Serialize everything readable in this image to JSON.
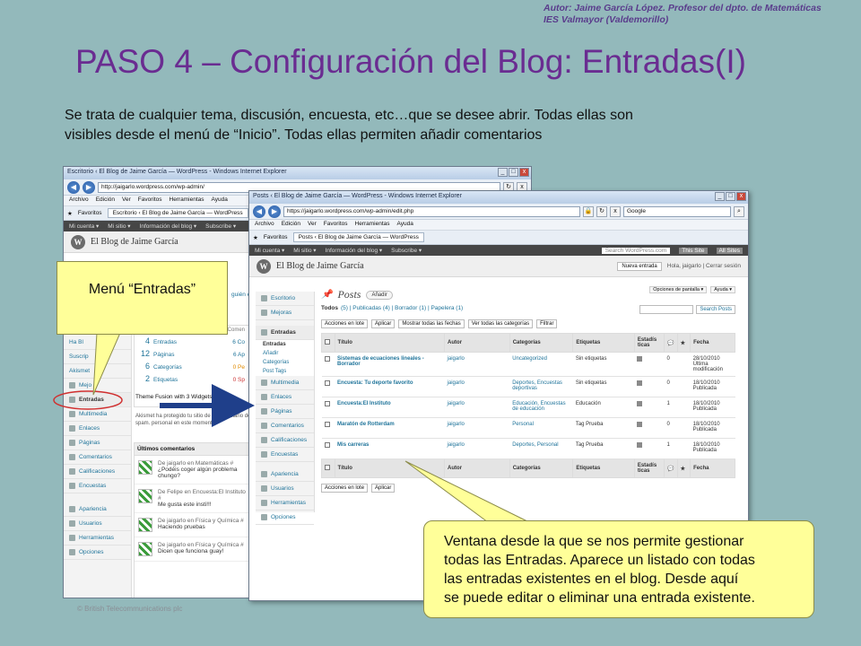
{
  "slide": {
    "author_line1": "Autor: Jaime García López. Profesor del dpto. de Matemáticas",
    "author_line2": "IES Valmayor (Valdemorillo)",
    "title": "PASO 4 – Configuración del Blog: Entradas(I)",
    "intro_line1": "Se trata de cualquier tema, discusión, encuesta, etc…que se desee abrir. Todas ellas son",
    "intro_line2": "visibles desde el menú de “Inicio”. Todas ellas permiten añadir comentarios",
    "copyright": "© British Telecommunications plc"
  },
  "callouts": {
    "menu": "Menú “Entradas”",
    "posts_line1": "Ventana desde la que se nos permite gestionar",
    "posts_line2": "todas las Entradas. Aparece un listado con todas",
    "posts_line3": "las entradas existentes en el blog. Desde aquí",
    "posts_line4": "se puede editar o eliminar una entrada existente."
  },
  "back_window": {
    "title": "Escritorio ‹ El Blog de Jaime García — WordPress - Windows Internet Explorer",
    "url": "http://jaigarlo.wordpress.com/wp-admin/",
    "menu": [
      "Archivo",
      "Edición",
      "Ver",
      "Favoritos",
      "Herramientas",
      "Ayuda"
    ],
    "fav_label": "Favoritos",
    "tab": "Escritorio ‹ El Blog de Jaime García — WordPress",
    "wpbar": [
      "Mi cuenta ▾",
      "Mi sitio ▾",
      "Información del blog ▾",
      "Subscribe ▾"
    ],
    "blog_name": "El Blog de Jaime García",
    "side_items": [
      "Escritorio",
      "Mejoras",
      "Entradas",
      "Multimedia",
      "Enlaces",
      "Páginas",
      "Comentarios",
      "Calificaciones",
      "Encuestas",
      "Apariencia",
      "Usuarios",
      "Herramientas",
      "Opciones"
    ],
    "side_fragments": [
      "Ha Bl",
      "Suscrip",
      "Akismet",
      "Mejo"
    ],
    "ahora": [
      {
        "n": "4",
        "label": "Entradas"
      },
      {
        "n": "12",
        "label": "Páginas"
      },
      {
        "n": "6",
        "label": "Categorías"
      },
      {
        "n": "2",
        "label": "Etiquetas"
      }
    ],
    "ahora_right": [
      "6 Co",
      "6 Ap",
      "0 Pe",
      "0 Sp"
    ],
    "comments_col": "Comen",
    "help_link": "guién ere",
    "theme_text": "Theme Fusion with 3 Widgets",
    "akismet_text": "Akismet ha protegido tu sitio de 1 comentario de spam. personal en este momento.",
    "recent_title": "Últimos comentarios",
    "recent": [
      {
        "who": "De jaigarlo en Matemáticas #",
        "text": "¿Podéis coger algún problema chungo?"
      },
      {
        "who": "De Felipe en Encuesta:El Instituto #",
        "text": "Me gusta este insti!!!"
      },
      {
        "who": "De jaigarlo en Física y Química #",
        "text": "Haciendo pruebas"
      },
      {
        "who": "De jaigarlo en Física y Química #",
        "text": "Dicen que funciona guay!"
      }
    ]
  },
  "front_window": {
    "title": "Posts ‹ El Blog de Jaime García — WordPress - Windows Internet Explorer",
    "url": "https://jaigarlo.wordpress.com/wp-admin/edit.php",
    "search_engine": "Google",
    "menu": [
      "Archivo",
      "Edición",
      "Ver",
      "Favoritos",
      "Herramientas",
      "Ayuda"
    ],
    "fav_label": "Favoritos",
    "tab": "Posts ‹ El Blog de Jaime García — WordPress",
    "wpbar": [
      "Mi cuenta ▾",
      "Mi sitio ▾",
      "Información del blog ▾",
      "Subscribe ▾"
    ],
    "wp_search": "Search WordPress.com",
    "this_site": "This Site",
    "all_sites": "All Sites",
    "blog_name": "El Blog de Jaime García",
    "new_entry": "Nueva entrada",
    "greeting": "Hola, jaigarlo | Cerrar sesión",
    "screen_options": "Opciones de pantalla ▾",
    "help": "Ayuda ▾",
    "side_items": [
      "Escritorio",
      "Mejoras",
      "Entradas",
      "Multimedia",
      "Enlaces",
      "Páginas",
      "Comentarios",
      "Calificaciones",
      "Encuestas",
      "Apariencia",
      "Usuarios",
      "Herramientas",
      "Opciones"
    ],
    "side_sub": [
      "Entradas",
      "Añadir",
      "Categorías",
      "Post Tags"
    ],
    "posts_title": "Posts",
    "add_button": "Añadir",
    "filter_all": "Todos",
    "filters": "(5) | Publicadas (4) | Borrador (1) | Papelera (1)",
    "search_posts": "Search Posts",
    "bulk_action": "Acciones en lote",
    "apply": "Aplicar",
    "all_dates": "Mostrar todas las fechas",
    "all_categories": "Ver todas las categorías",
    "filter_button": "Filtrar",
    "columns": [
      "Título",
      "Autor",
      "Categorías",
      "Etiquetas",
      "Estadís ticas",
      "",
      "",
      "Fecha"
    ],
    "rows": [
      {
        "title": "Sistemas de ecuaciones lineales - Borrador",
        "author": "jaigarlo",
        "cats": "Uncategorized",
        "tags": "Sin etiquetas",
        "comments": "0",
        "date": "28/10/2010",
        "status": "Última modificación"
      },
      {
        "title": "Encuesta: Tu deporte favorito",
        "author": "jaigarlo",
        "cats": "Deportes, Encuestas deportivas",
        "tags": "Sin etiquetas",
        "comments": "0",
        "date": "18/10/2010",
        "status": "Publicada"
      },
      {
        "title": "Encuesta:El Instituto",
        "author": "jaigarlo",
        "cats": "Educación, Encuestas de educación",
        "tags": "Educación",
        "comments": "1",
        "date": "18/10/2010",
        "status": "Publicada"
      },
      {
        "title": "Maratón de Rotterdam",
        "author": "jaigarlo",
        "cats": "Personal",
        "tags": "Tag Prueba",
        "comments": "0",
        "date": "18/10/2010",
        "status": "Publicada"
      },
      {
        "title": "Mis carreras",
        "author": "jaigarlo",
        "cats": "Deportes, Personal",
        "tags": "Tag Prueba",
        "comments": "1",
        "date": "18/10/2010",
        "status": "Publicada"
      }
    ]
  }
}
